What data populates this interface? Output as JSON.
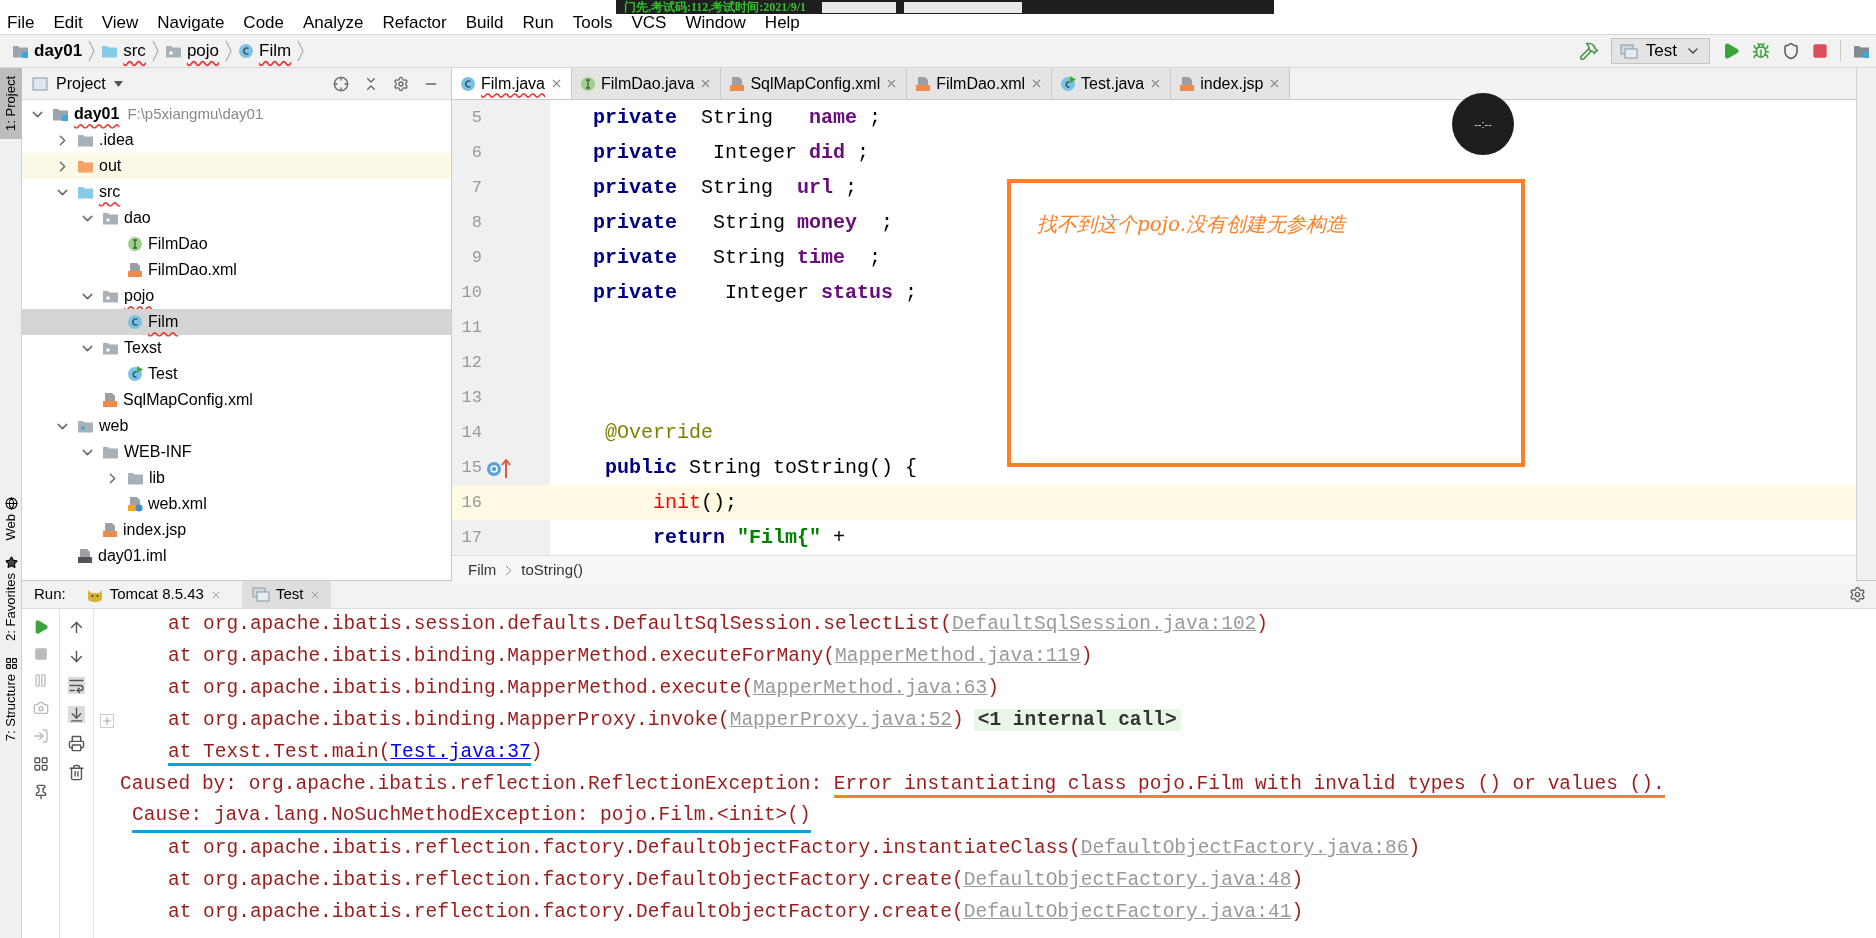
{
  "exam_banner": {
    "text": "门先,考试码:112,考试时间:2021/9/1"
  },
  "menu": [
    "File",
    "Edit",
    "View",
    "Navigate",
    "Code",
    "Analyze",
    "Refactor",
    "Build",
    "Run",
    "Tools",
    "VCS",
    "Window",
    "Help"
  ],
  "breadcrumb": [
    {
      "label": "day01",
      "kind": "module",
      "error": false,
      "bold": true
    },
    {
      "label": "src",
      "kind": "folder_source",
      "error": true,
      "bold": false
    },
    {
      "label": "pojo",
      "kind": "package",
      "error": true,
      "bold": false
    },
    {
      "label": "Film",
      "kind": "class",
      "error": true,
      "bold": false
    }
  ],
  "run_config": {
    "label": "Test"
  },
  "left_stripe_top": [
    {
      "label": "1: Project",
      "selected": true
    }
  ],
  "left_stripe_bottom": [
    {
      "label": "Web",
      "kind": "globe",
      "selected": false
    },
    {
      "label": "2: Favorites",
      "kind": "star",
      "selected": false
    },
    {
      "label": "7: Structure",
      "kind": "structure",
      "selected": false
    }
  ],
  "project": {
    "title": "Project",
    "tree": [
      {
        "label": "day01",
        "note": "F:\\p5xiangmu\\day01",
        "kind": "module",
        "expanded": true,
        "selected": false,
        "error": true,
        "highlighted": false,
        "bold": true,
        "children": [
          {
            "label": ".idea",
            "kind": "folder",
            "expanded": false,
            "selected": false,
            "error": false,
            "highlighted": false
          },
          {
            "label": "out",
            "kind": "folder_excluded",
            "expanded": false,
            "selected": false,
            "error": false,
            "highlighted": true
          },
          {
            "label": "src",
            "kind": "folder_source",
            "expanded": true,
            "selected": false,
            "error": true,
            "highlighted": false,
            "children": [
              {
                "label": "dao",
                "kind": "package",
                "expanded": true,
                "selected": false,
                "error": false,
                "highlighted": false,
                "children": [
                  {
                    "label": "FilmDao",
                    "kind": "interface",
                    "selected": false,
                    "error": false,
                    "highlighted": false
                  },
                  {
                    "label": "FilmDao.xml",
                    "kind": "xml",
                    "selected": false,
                    "error": false,
                    "highlighted": false
                  }
                ]
              },
              {
                "label": "pojo",
                "kind": "package",
                "expanded": true,
                "selected": false,
                "error": true,
                "highlighted": false,
                "children": [
                  {
                    "label": "Film",
                    "kind": "class",
                    "selected": true,
                    "error": true,
                    "highlighted": false
                  }
                ]
              },
              {
                "label": "Texst",
                "kind": "package",
                "expanded": true,
                "selected": false,
                "error": false,
                "highlighted": false,
                "children": [
                  {
                    "label": "Test",
                    "kind": "class_run",
                    "selected": false,
                    "error": false,
                    "highlighted": false
                  }
                ]
              },
              {
                "label": "SqlMapConfig.xml",
                "kind": "xml",
                "selected": false,
                "error": false,
                "highlighted": false
              }
            ]
          },
          {
            "label": "web",
            "kind": "web_folder",
            "expanded": true,
            "selected": false,
            "error": false,
            "highlighted": false,
            "children": [
              {
                "label": "WEB-INF",
                "kind": "folder",
                "expanded": true,
                "selected": false,
                "error": false,
                "highlighted": false,
                "children": [
                  {
                    "label": "lib",
                    "kind": "folder",
                    "expanded": false,
                    "selected": false,
                    "error": false,
                    "highlighted": false
                  },
                  {
                    "label": "web.xml",
                    "kind": "webxml",
                    "selected": false,
                    "error": false,
                    "highlighted": false
                  }
                ]
              },
              {
                "label": "index.jsp",
                "kind": "jsp",
                "selected": false,
                "error": false,
                "highlighted": false
              }
            ]
          },
          {
            "label": "day01.iml",
            "kind": "iml",
            "selected": false,
            "error": false,
            "highlighted": false
          }
        ]
      }
    ]
  },
  "editor": {
    "tabs": [
      {
        "label": "Film.java",
        "kind": "class",
        "selected": true,
        "error": true
      },
      {
        "label": "FilmDao.java",
        "kind": "interface",
        "selected": false,
        "error": false
      },
      {
        "label": "SqlMapConfig.xml",
        "kind": "xml",
        "selected": false,
        "error": false
      },
      {
        "label": "FilmDao.xml",
        "kind": "xml",
        "selected": false,
        "error": false
      },
      {
        "label": "Test.java",
        "kind": "class_run",
        "selected": false,
        "error": false
      },
      {
        "label": "index.jsp",
        "kind": "jsp",
        "selected": false,
        "error": false
      }
    ],
    "lines": [
      {
        "number": "5",
        "kind": "member",
        "current": false,
        "tokens": [
          {
            "text": "private",
            "kind": "kw"
          },
          {
            "text": "  String   ",
            "kind": "type"
          },
          {
            "text": "name",
            "kind": "field"
          },
          {
            "text": " ;",
            "kind": "plain"
          }
        ]
      },
      {
        "number": "6",
        "kind": "member",
        "current": false,
        "tokens": [
          {
            "text": "private",
            "kind": "kw"
          },
          {
            "text": "   Integer ",
            "kind": "type"
          },
          {
            "text": "did",
            "kind": "field"
          },
          {
            "text": " ;",
            "kind": "plain"
          }
        ]
      },
      {
        "number": "7",
        "kind": "member",
        "current": false,
        "tokens": [
          {
            "text": "private",
            "kind": "kw"
          },
          {
            "text": "  String  ",
            "kind": "type"
          },
          {
            "text": "url",
            "kind": "field"
          },
          {
            "text": " ;",
            "kind": "plain"
          }
        ]
      },
      {
        "number": "8",
        "kind": "member",
        "current": false,
        "tokens": [
          {
            "text": "private",
            "kind": "kw"
          },
          {
            "text": "   String ",
            "kind": "type"
          },
          {
            "text": "money",
            "kind": "field"
          },
          {
            "text": "  ;",
            "kind": "plain"
          }
        ]
      },
      {
        "number": "9",
        "kind": "member",
        "current": false,
        "tokens": [
          {
            "text": "private",
            "kind": "kw"
          },
          {
            "text": "   String ",
            "kind": "type"
          },
          {
            "text": "time",
            "kind": "field"
          },
          {
            "text": "  ;",
            "kind": "plain"
          }
        ]
      },
      {
        "number": "10",
        "kind": "member",
        "current": false,
        "tokens": [
          {
            "text": "private",
            "kind": "kw"
          },
          {
            "text": "    Integer ",
            "kind": "type"
          },
          {
            "text": "status",
            "kind": "field"
          },
          {
            "text": " ;",
            "kind": "plain"
          }
        ]
      },
      {
        "number": "11",
        "current": false
      },
      {
        "number": "12",
        "current": false
      },
      {
        "number": "13",
        "current": false
      },
      {
        "number": "14",
        "kind": "method",
        "current": false,
        "tokens": [
          {
            "text": "@Override",
            "kind": "annotation"
          }
        ]
      },
      {
        "number": "15",
        "kind": "method",
        "current": false,
        "overrides": true,
        "tokens": [
          {
            "text": "public",
            "kind": "kw"
          },
          {
            "text": " String toString() {",
            "kind": "type"
          }
        ]
      },
      {
        "number": "16",
        "kind": "statement",
        "current": true,
        "tokens": [
          {
            "text": "init",
            "kind": "error"
          },
          {
            "text": "();",
            "kind": "plain"
          }
        ]
      },
      {
        "number": "17",
        "kind": "statement",
        "current": false,
        "tokens": [
          {
            "text": "return",
            "kind": "kw"
          },
          {
            "text": " \"Film{\"",
            "kind": "string"
          },
          {
            "text": " +",
            "kind": "plain"
          }
        ]
      }
    ],
    "note": {
      "text": "找不到这个pojo.没有创建无参构造"
    },
    "breadcrumb": [
      "Film",
      "toString()"
    ]
  },
  "timer": {
    "text": "--:--"
  },
  "run": {
    "label": "Run:",
    "tabs": [
      {
        "label": "Tomcat 8.5.43",
        "kind": "tomcat",
        "selected": false
      },
      {
        "label": "Test",
        "kind": "app",
        "selected": true
      }
    ],
    "lines": [
      {
        "kind": "frame",
        "folded": false,
        "segments": [
          {
            "text": "at org.apache.ibatis.session.defaults.DefaultSqlSession.selectList(",
            "kind": "text"
          },
          {
            "text": "DefaultSqlSession.java:102",
            "kind": "link"
          },
          {
            "text": ")",
            "kind": "text"
          }
        ]
      },
      {
        "kind": "frame",
        "folded": false,
        "segments": [
          {
            "text": "at org.apache.ibatis.binding.MapperMethod.executeForMany(",
            "kind": "text"
          },
          {
            "text": "MapperMethod.java:119",
            "kind": "link"
          },
          {
            "text": ")",
            "kind": "text"
          }
        ]
      },
      {
        "kind": "frame",
        "folded": false,
        "segments": [
          {
            "text": "at org.apache.ibatis.binding.MapperMethod.execute(",
            "kind": "text"
          },
          {
            "text": "MapperMethod.java:63",
            "kind": "link"
          },
          {
            "text": ")",
            "kind": "text"
          }
        ]
      },
      {
        "kind": "frame",
        "folded": true,
        "segments": [
          {
            "text": "at org.apache.ibatis.binding.MapperProxy.invoke(",
            "kind": "text"
          },
          {
            "text": "MapperProxy.java:52",
            "kind": "link"
          },
          {
            "text": ")",
            "kind": "text"
          },
          {
            "text": "<1 internal call>",
            "kind": "folded"
          }
        ]
      },
      {
        "kind": "frame",
        "folded": false,
        "segments": [
          {
            "text": "at Texst.Test.main(",
            "kind": "text",
            "color": "#0aa0e6"
          },
          {
            "text": "Test.java:37",
            "kind": "source_link",
            "color": "#0aa0e6"
          },
          {
            "text": ")",
            "kind": "text"
          }
        ]
      },
      {
        "kind": "caused",
        "folded": false,
        "segments": [
          {
            "text": "Caused by: org.apache.ibatis.reflection.ReflectionException: ",
            "kind": "text"
          },
          {
            "text": "Error instantiating class pojo.Film with invalid types () or values ().",
            "kind": "text",
            "color": "#ff7f27"
          }
        ]
      },
      {
        "kind": "cause",
        "segments": [
          {
            "text": "Cause: java.lang.NoSuchMethodException: pojo.Film.<init>()",
            "kind": "text",
            "color": "#0aa0e6"
          }
        ]
      },
      {
        "kind": "frame",
        "folded": false,
        "segments": [
          {
            "text": "at org.apache.ibatis.reflection.factory.DefaultObjectFactory.instantiateClass(",
            "kind": "text"
          },
          {
            "text": "DefaultObjectFactory.java:86",
            "kind": "link"
          },
          {
            "text": ")",
            "kind": "text"
          }
        ]
      },
      {
        "kind": "frame",
        "folded": false,
        "segments": [
          {
            "text": "at org.apache.ibatis.reflection.factory.DefaultObjectFactory.create(",
            "kind": "text"
          },
          {
            "text": "DefaultObjectFactory.java:48",
            "kind": "link"
          },
          {
            "text": ")",
            "kind": "text"
          }
        ]
      },
      {
        "kind": "frame",
        "folded": false,
        "segments": [
          {
            "text": "at org.apache.ibatis.reflection.factory.DefaultObjectFactory.create(",
            "kind": "text"
          },
          {
            "text": "DefaultObjectFactory.java:41",
            "kind": "link"
          },
          {
            "text": ")",
            "kind": "text"
          }
        ]
      }
    ]
  }
}
